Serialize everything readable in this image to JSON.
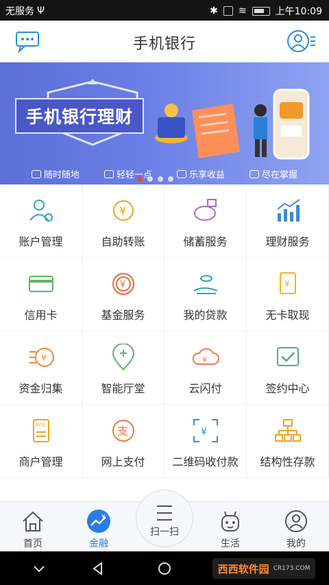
{
  "status": {
    "carrier": "无服务",
    "time": "上午10:09"
  },
  "header": {
    "title": "手机银行"
  },
  "banner": {
    "title": "手机银行理财",
    "features": [
      "随时随地",
      "轻轻一点",
      "乐享收益",
      "尽在掌握"
    ]
  },
  "grid": {
    "items": [
      {
        "label": "账户管理",
        "icon": "account-icon",
        "color": "#2fa6b8"
      },
      {
        "label": "自助转账",
        "icon": "transfer-icon",
        "color": "#f0a21e"
      },
      {
        "label": "储蓄服务",
        "icon": "piggy-bank-icon",
        "color": "#a869c9"
      },
      {
        "label": "理财服务",
        "icon": "chart-icon",
        "color": "#3b8ad8"
      },
      {
        "label": "信用卡",
        "icon": "credit-card-icon",
        "color": "#5cb85c"
      },
      {
        "label": "基金服务",
        "icon": "fund-icon",
        "color": "#e86b3a"
      },
      {
        "label": "我的贷款",
        "icon": "loan-icon",
        "color": "#2fa6b8"
      },
      {
        "label": "无卡取现",
        "icon": "cardless-icon",
        "color": "#f0b31e"
      },
      {
        "label": "资金归集",
        "icon": "collection-icon",
        "color": "#f08a2c"
      },
      {
        "label": "智能厅堂",
        "icon": "location-icon",
        "color": "#5cb85c"
      },
      {
        "label": "云闪付",
        "icon": "cloud-pay-icon",
        "color": "#f07a4a"
      },
      {
        "label": "签约中心",
        "icon": "contract-icon",
        "color": "#4caf7a"
      },
      {
        "label": "商户管理",
        "icon": "pos-icon",
        "color": "#f0a21e"
      },
      {
        "label": "网上支付",
        "icon": "online-pay-icon",
        "color": "#f07a3a"
      },
      {
        "label": "二维码收付款",
        "icon": "qr-code-icon",
        "color": "#2f8fd8"
      },
      {
        "label": "结构性存款",
        "icon": "structure-icon",
        "color": "#f0a21e"
      }
    ]
  },
  "tabs": [
    {
      "label": "首页",
      "icon": "home-icon"
    },
    {
      "label": "金融",
      "icon": "finance-icon"
    },
    {
      "label": "扫一扫",
      "icon": "scan-icon"
    },
    {
      "label": "生活",
      "icon": "life-icon"
    },
    {
      "label": "我的",
      "icon": "me-icon"
    }
  ],
  "watermark": {
    "text": "西西软件园",
    "sub": "CR173.COM"
  },
  "colors": {
    "accent": "#2a7de1",
    "banner": "#6b7fe6"
  }
}
